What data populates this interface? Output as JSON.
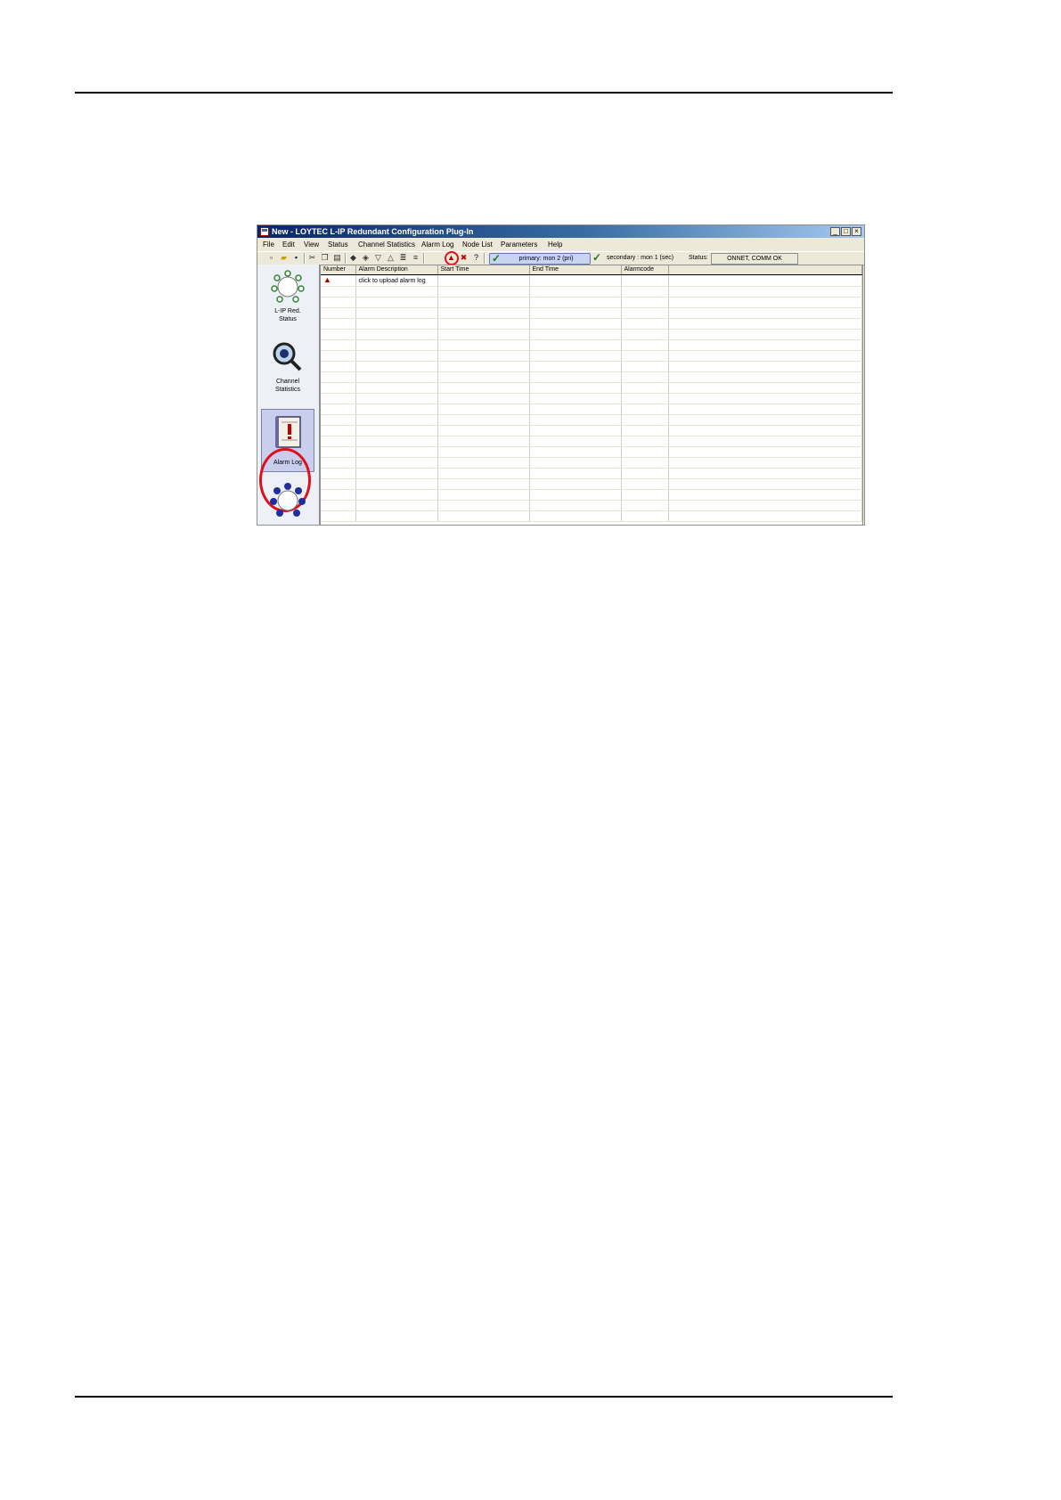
{
  "window": {
    "title": "New - LOYTEC L-IP Redundant Configuration Plug-In",
    "buttons": [
      "_",
      "□",
      "×"
    ]
  },
  "menu": [
    "File",
    "Edit",
    "View",
    "Status",
    "Channel Statistics",
    "Alarm Log",
    "Node List",
    "Parameters",
    "Help"
  ],
  "toolbar": {
    "primary": "primary: mon 2 (pri)",
    "secondary": "secondary : mon 1 (sec)",
    "status_label": "Status:",
    "status_value": "ONNET, COMM OK",
    "check_color": "#1a7a1a"
  },
  "sidebar": {
    "items": [
      {
        "label_1": "L-IP Red.",
        "label_2": "Status",
        "icon": "network-ring-icon"
      },
      {
        "label_1": "Channel",
        "label_2": "Statistics",
        "icon": "magnifier-icon"
      },
      {
        "label_1": "Alarm Log",
        "label_2": "",
        "icon": "alarm-book-icon",
        "active": true
      },
      {
        "label_1": "",
        "label_2": "",
        "icon": "node-ring-icon"
      }
    ]
  },
  "table": {
    "columns": [
      "Number",
      "Alarm Description",
      "Start Time",
      "End Time",
      "Alarmcode",
      ""
    ],
    "first_row_description": "click to upload alarm log"
  },
  "accent": "#e0101a"
}
